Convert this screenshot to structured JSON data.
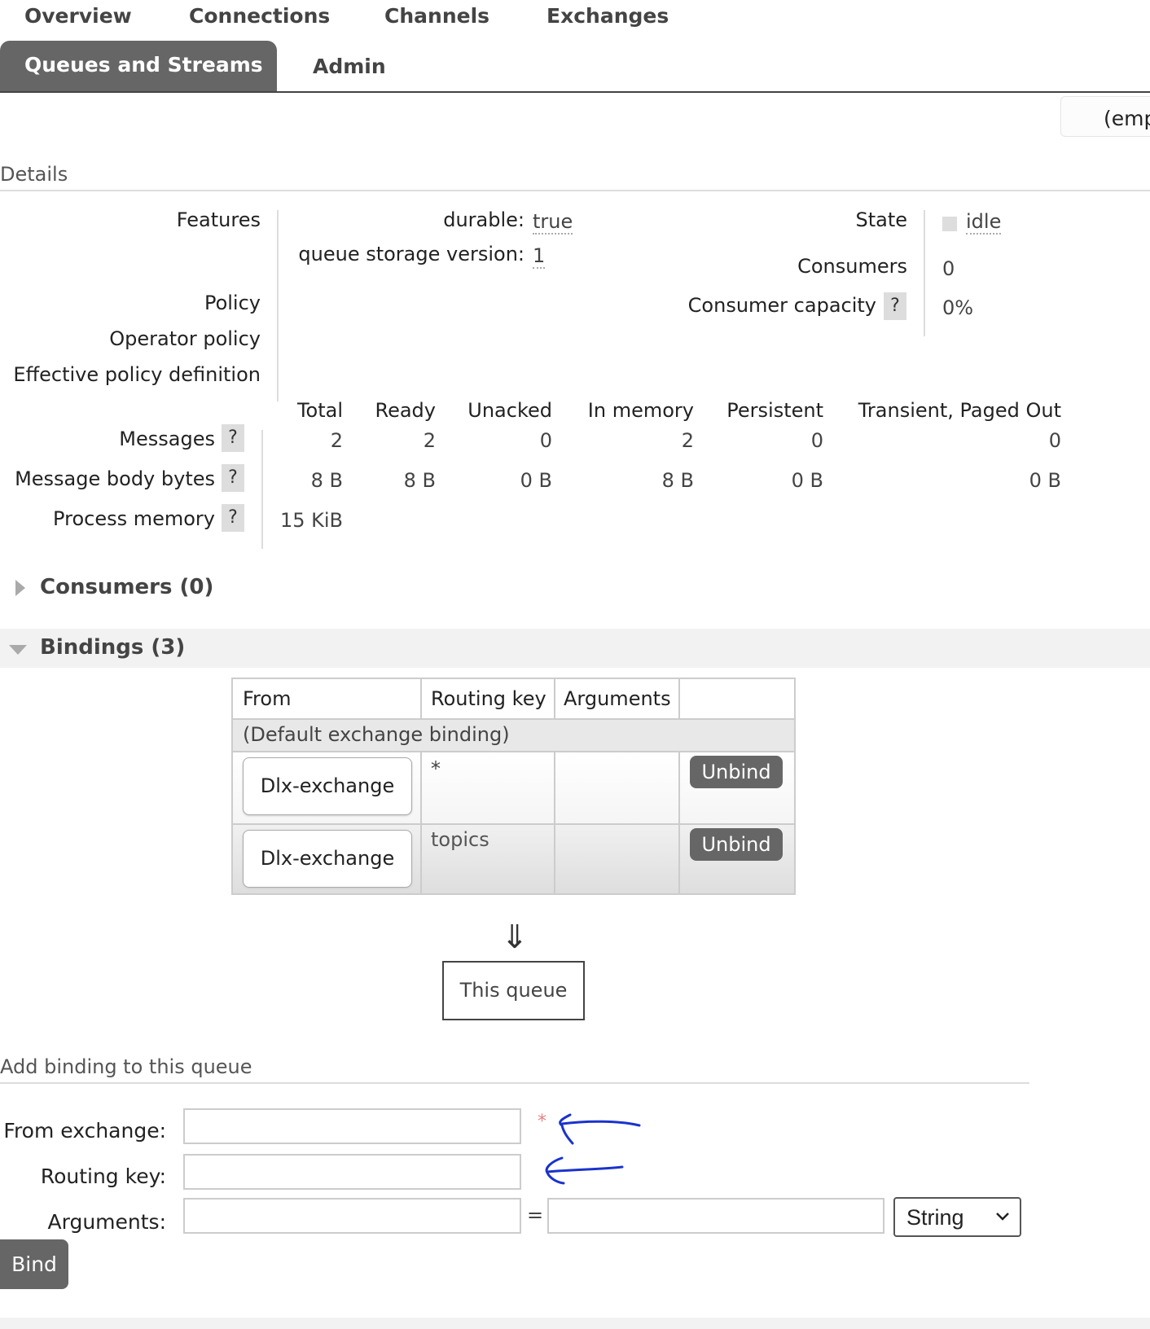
{
  "nav": {
    "items": [
      "Overview",
      "Connections",
      "Channels",
      "Exchanges"
    ],
    "active": "Queues and Streams",
    "admin": "Admin"
  },
  "vhost": {
    "value": "(emp"
  },
  "details": {
    "title": "Details",
    "features_label": "Features",
    "durable_label": "durable:",
    "durable_value": "true",
    "qsv_label": "queue storage version:",
    "qsv_value": "1",
    "policy_label": "Policy",
    "operator_policy_label": "Operator policy",
    "effective_policy_label": "Effective policy definition",
    "state_label": "State",
    "state_value": "idle",
    "consumers_label": "Consumers",
    "consumers_value": "0",
    "consumer_capacity_label": "Consumer capacity",
    "consumer_capacity_value": "0%",
    "help": "?"
  },
  "messages": {
    "columns": [
      "Total",
      "Ready",
      "Unacked",
      "In memory",
      "Persistent",
      "Transient, Paged Out"
    ],
    "rows": [
      {
        "label": "Messages",
        "values": [
          "2",
          "2",
          "0",
          "2",
          "0",
          "0"
        ]
      },
      {
        "label": "Message body bytes",
        "values": [
          "8 B",
          "8 B",
          "0 B",
          "8 B",
          "0 B",
          "0 B"
        ]
      },
      {
        "label": "Process memory",
        "values": [
          "15 KiB"
        ]
      }
    ]
  },
  "consumers_section": {
    "title": "Consumers (0)"
  },
  "bindings": {
    "title": "Bindings (3)",
    "columns": [
      "From",
      "Routing key",
      "Arguments"
    ],
    "default_binding": "(Default exchange binding)",
    "rows": [
      {
        "from": "Dlx-exchange",
        "routing_key": "*",
        "arguments": "",
        "action": "Unbind"
      },
      {
        "from": "Dlx-exchange",
        "routing_key": "topics",
        "arguments": "",
        "action": "Unbind"
      }
    ],
    "arrow": "⇓",
    "this_queue": "This queue"
  },
  "add_binding": {
    "title": "Add binding to this queue",
    "from_exchange_label": "From exchange:",
    "required_mark": "*",
    "routing_key_label": "Routing key:",
    "arguments_label": "Arguments:",
    "equals": "=",
    "type_selected": "String",
    "bind_label": "Bind"
  },
  "colors": {
    "nav_active_bg": "#666666",
    "button_bg": "#666666",
    "required": "#e88080",
    "annotation": "#1a33cc"
  }
}
